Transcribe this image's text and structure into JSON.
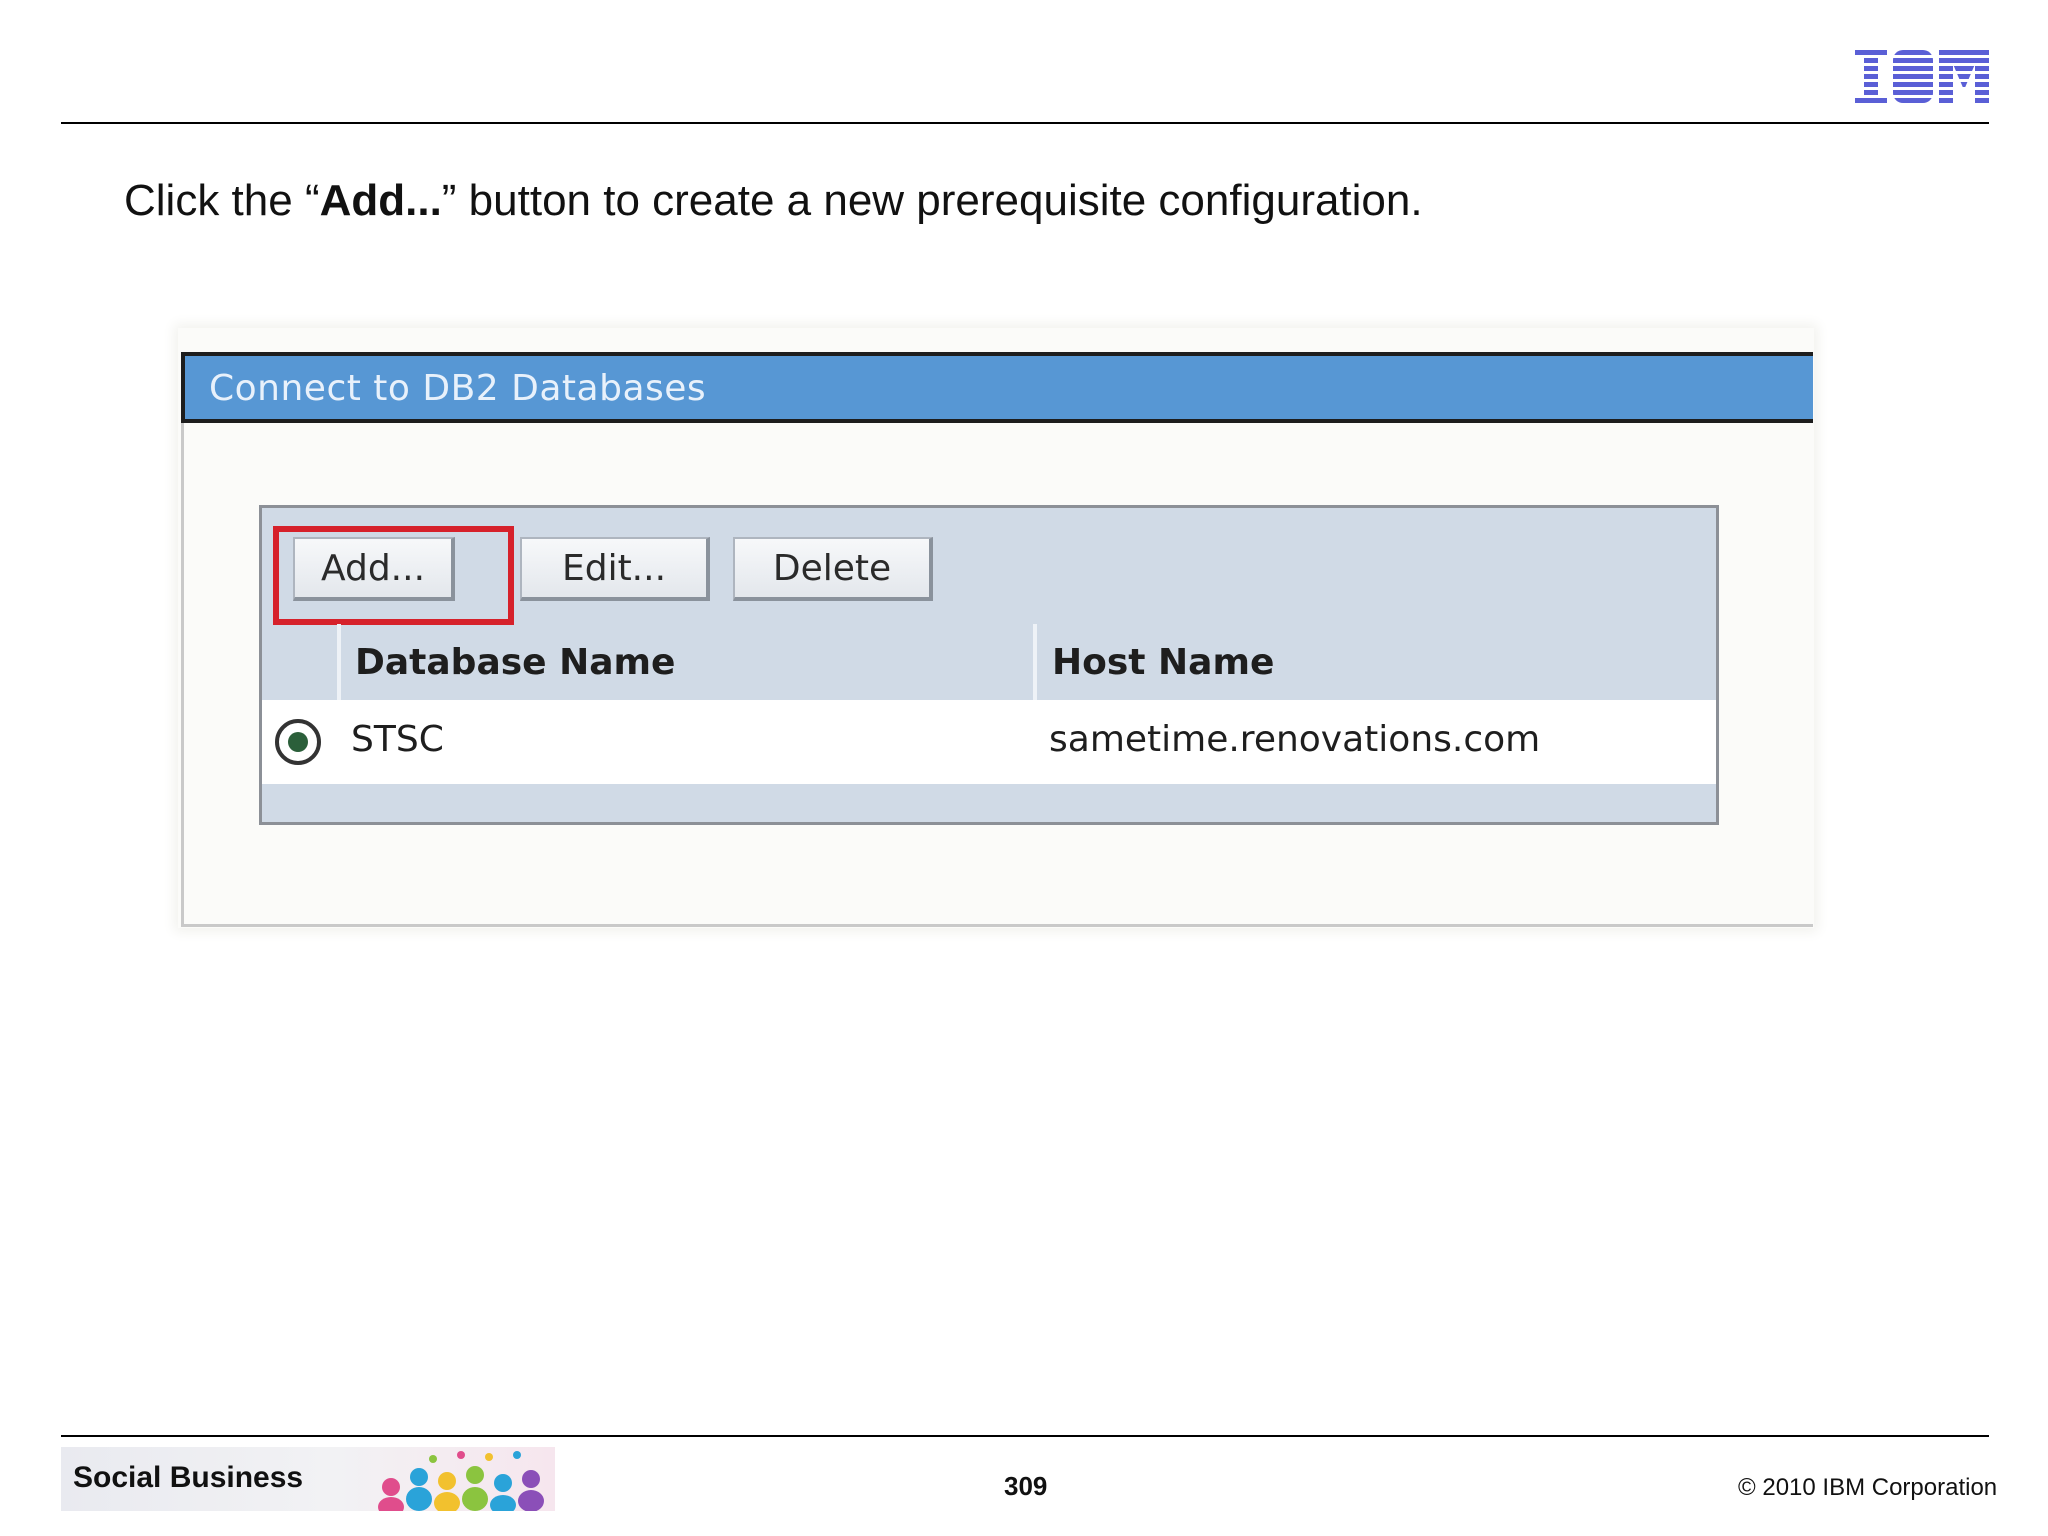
{
  "slide": {
    "instruction_before": "Click the “",
    "instruction_bold": "Add...",
    "instruction_after": "” button to create a new prerequisite configuration.",
    "logo_text": "IBM"
  },
  "panel": {
    "title": "Connect to DB2 Databases",
    "buttons": {
      "add": "Add...",
      "edit": "Edit...",
      "delete": "Delete"
    },
    "columns": [
      "Database Name",
      "Host Name"
    ],
    "rows": [
      {
        "database_name": "STSC",
        "host_name": "sametime.renovations.com",
        "selected": true
      }
    ]
  },
  "footer": {
    "brand": "Social Business",
    "page_number": "309",
    "copyright": "© 2010 IBM Corporation"
  },
  "colors": {
    "header_blue": "#5797d4",
    "highlight_red": "#d6212b",
    "ibm_blue": "#5a5fd6"
  }
}
